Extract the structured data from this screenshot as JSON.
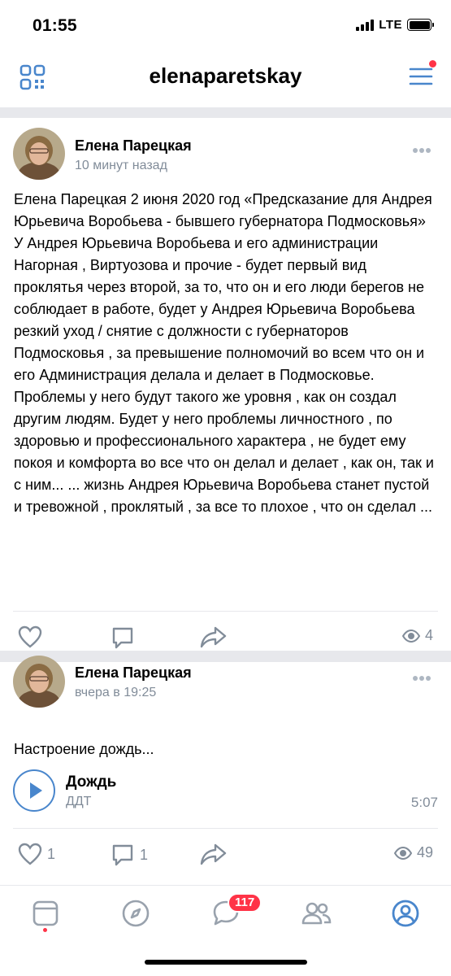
{
  "status_bar": {
    "time": "01:55",
    "network": "LTE"
  },
  "header": {
    "title": "elenaparetskay"
  },
  "posts": [
    {
      "author": "Елена Парецкая",
      "time": "10 минут назад",
      "text": "Елена Парецкая 2 июня 2020 год «Предсказание для Андрея Юрьевича  Воробьева - бывшего губернатора Подмосковья»\nУ Андрея Юрьевича Воробьева и его администрации Нагорная , Виртуозова и прочие - будет первый вид проклятья через второй, за то, что он и его люди берегов не соблюдает в работе, будет у Андрея Юрьевича Воробьева резкий уход / снятие с должности с губернаторов Подмосковья , за превышение полномочий во всем что он и его Администрация делала и делает в Подмосковье. Проблемы у него будут такого же уровня , как он создал другим людям. Будет у него проблемы личностного , по здоровью и профессионального характера , не будет ему покоя и комфорта во все что он делал и делает , как он, так и с ним... ... жизнь Андрея Юрьевича Воробьева станет пустой и тревожной , проклятый , за все то плохое , что он сделал ...",
      "likes": "",
      "comments": "",
      "views": "4"
    },
    {
      "author": "Елена Парецкая",
      "time": "вчера в 19:25",
      "text": "Настроение дождь...",
      "audio": {
        "title": "Дождь",
        "artist": "ДДТ",
        "duration": "5:07"
      },
      "likes": "1",
      "comments": "1",
      "views": "49"
    }
  ],
  "tabbar": {
    "tabs": [
      "news",
      "discover",
      "messenger",
      "friends",
      "profile"
    ],
    "messages_badge": "117"
  },
  "colors": {
    "accent": "#4986cc",
    "badge": "#ff3347",
    "secondary_text": "#818c99",
    "separator": "#e7e8ec"
  }
}
